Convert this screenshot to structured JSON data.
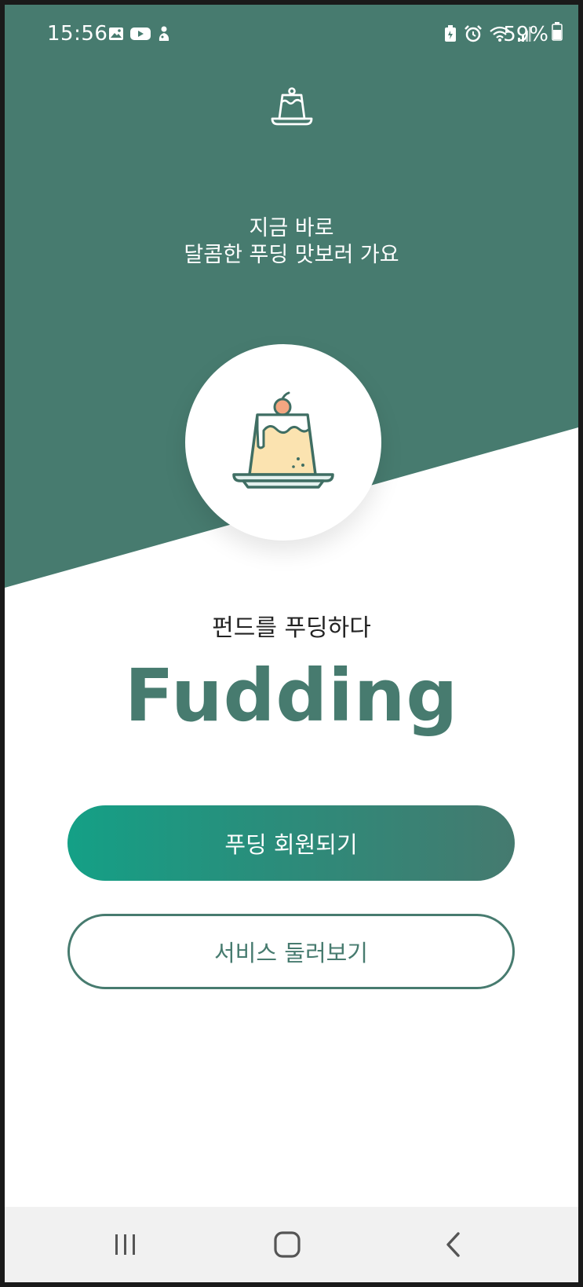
{
  "status_bar": {
    "time": "15:56",
    "battery_percent": "59%",
    "left_icons": [
      "gallery-icon",
      "youtube-icon",
      "app-notification-icon"
    ],
    "right_icons": [
      "battery-saver-icon",
      "alarm-icon",
      "wifi-icon",
      "signal-icon",
      "battery-icon"
    ]
  },
  "header": {
    "logo_icon": "pudding-outline-icon",
    "headline_line1": "지금 바로",
    "headline_line2": "달콤한 푸딩 맛보러 가요"
  },
  "hero": {
    "illustration_icon": "pudding-icon"
  },
  "main": {
    "tagline": "펀드를 푸딩하다",
    "brand": "Fudding",
    "signup_label": "푸딩 회원되기",
    "browse_label": "서비스 둘러보기"
  },
  "nav": {
    "recents_icon": "recents-icon",
    "home_icon": "home-icon",
    "back_icon": "back-icon"
  },
  "colors": {
    "brand_green": "#477b6f",
    "button_gradient_start": "#14a086",
    "button_gradient_end": "#457a6f",
    "pudding_fill": "#fbe3b0",
    "cherry": "#f3a681",
    "nav_bg": "#f1f1f1"
  }
}
